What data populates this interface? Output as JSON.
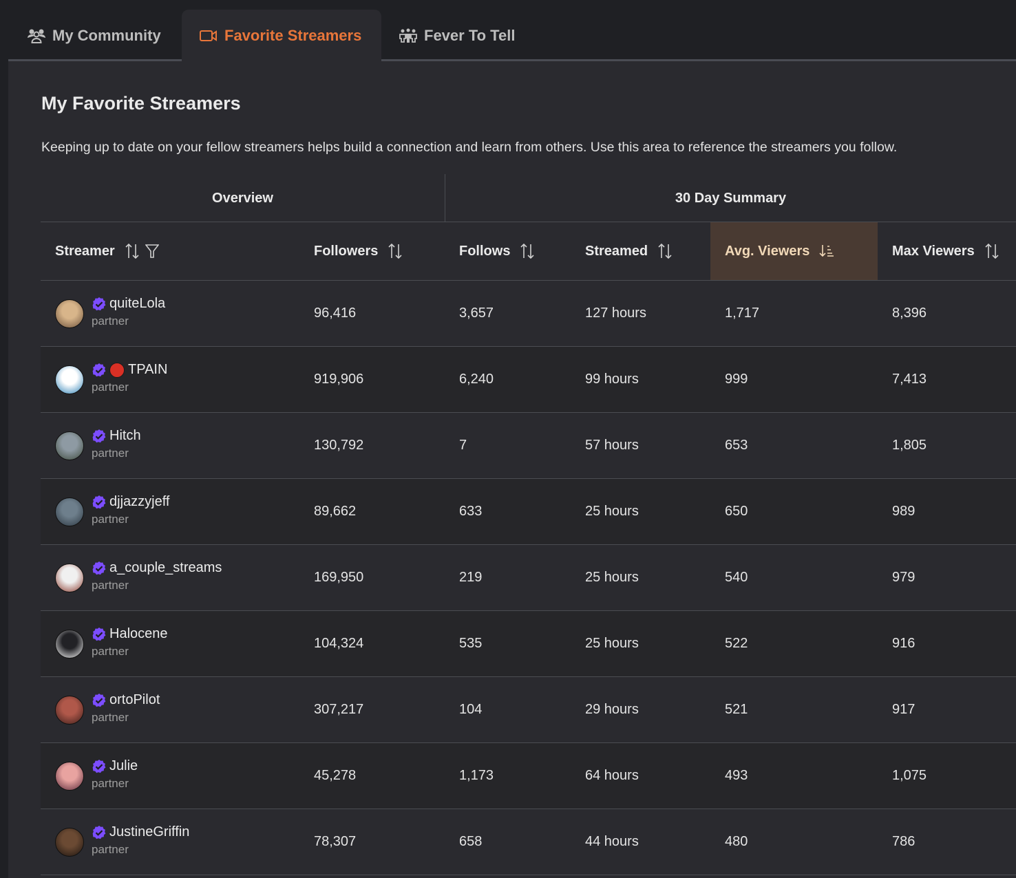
{
  "tabs": [
    {
      "label": "My Community",
      "icon": "users-icon",
      "active": false
    },
    {
      "label": "Favorite Streamers",
      "icon": "video-camera-icon",
      "active": true
    },
    {
      "label": "Fever To Tell",
      "icon": "group-icon",
      "active": false
    }
  ],
  "page": {
    "title": "My Favorite Streamers",
    "description": "Keeping up to date on your fellow streamers helps build a connection and learn from others. Use this area to reference the streamers you follow."
  },
  "table": {
    "groups": {
      "overview": "Overview",
      "summary": "30 Day Summary"
    },
    "columns": [
      {
        "label": "Streamer",
        "sort": "unsorted",
        "filter": true
      },
      {
        "label": "Followers",
        "sort": "unsorted"
      },
      {
        "label": "Follows",
        "sort": "unsorted"
      },
      {
        "label": "Streamed",
        "sort": "unsorted"
      },
      {
        "label": "Avg. Viewers",
        "sort": "descending",
        "active": true
      },
      {
        "label": "Max Viewers",
        "sort": "unsorted"
      }
    ],
    "colors": {
      "verified": "#7c4dff",
      "live": "#d93025",
      "active_tab": "#e8763a",
      "tab_indicator": "#5fbf6a",
      "active_column_bg": "#493a32"
    },
    "rows": [
      {
        "name": "quiteLola",
        "type": "partner",
        "verified": true,
        "live": false,
        "followers": "96,416",
        "follows": "3,657",
        "streamed": "127 hours",
        "avg_viewers": "1,717",
        "max_viewers": "8,396",
        "avatar_colors": [
          "#d8b58a",
          "#6a4f3a"
        ]
      },
      {
        "name": "TPAIN",
        "type": "partner",
        "verified": true,
        "live": true,
        "followers": "919,906",
        "follows": "6,240",
        "streamed": "99 hours",
        "avg_viewers": "999",
        "max_viewers": "7,413",
        "avatar_colors": [
          "#ffffff",
          "#2a7fb5"
        ]
      },
      {
        "name": "Hitch",
        "type": "partner",
        "verified": true,
        "live": false,
        "followers": "130,792",
        "follows": "7",
        "streamed": "57 hours",
        "avg_viewers": "653",
        "max_viewers": "1,805",
        "avatar_colors": [
          "#8e9aa3",
          "#3e4a3c"
        ]
      },
      {
        "name": "djjazzyjeff",
        "type": "partner",
        "verified": true,
        "live": false,
        "followers": "89,662",
        "follows": "633",
        "streamed": "25 hours",
        "avg_viewers": "650",
        "max_viewers": "989",
        "avatar_colors": [
          "#6e7f8c",
          "#2b3640"
        ]
      },
      {
        "name": "a_couple_streams",
        "type": "partner",
        "verified": true,
        "live": false,
        "followers": "169,950",
        "follows": "219",
        "streamed": "25 hours",
        "avg_viewers": "540",
        "max_viewers": "979",
        "avatar_colors": [
          "#f0f0f0",
          "#8b3a2e"
        ]
      },
      {
        "name": "Halocene",
        "type": "partner",
        "verified": true,
        "live": false,
        "followers": "104,324",
        "follows": "535",
        "streamed": "25 hours",
        "avg_viewers": "522",
        "max_viewers": "916",
        "avatar_colors": [
          "#222226",
          "#ffffff"
        ]
      },
      {
        "name": "ortoPilot",
        "type": "partner",
        "verified": true,
        "live": false,
        "followers": "307,217",
        "follows": "104",
        "streamed": "29 hours",
        "avg_viewers": "521",
        "max_viewers": "917",
        "avatar_colors": [
          "#b0584a",
          "#3b1e1a"
        ]
      },
      {
        "name": "Julie",
        "type": "partner",
        "verified": true,
        "live": false,
        "followers": "45,278",
        "follows": "1,173",
        "streamed": "64 hours",
        "avg_viewers": "493",
        "max_viewers": "1,075",
        "avatar_colors": [
          "#e8a3a0",
          "#5a2a3a"
        ]
      },
      {
        "name": "JustineGriffin",
        "type": "partner",
        "verified": true,
        "live": false,
        "followers": "78,307",
        "follows": "658",
        "streamed": "44 hours",
        "avg_viewers": "480",
        "max_viewers": "786",
        "avatar_colors": [
          "#6b4a33",
          "#1c1410"
        ]
      }
    ]
  }
}
